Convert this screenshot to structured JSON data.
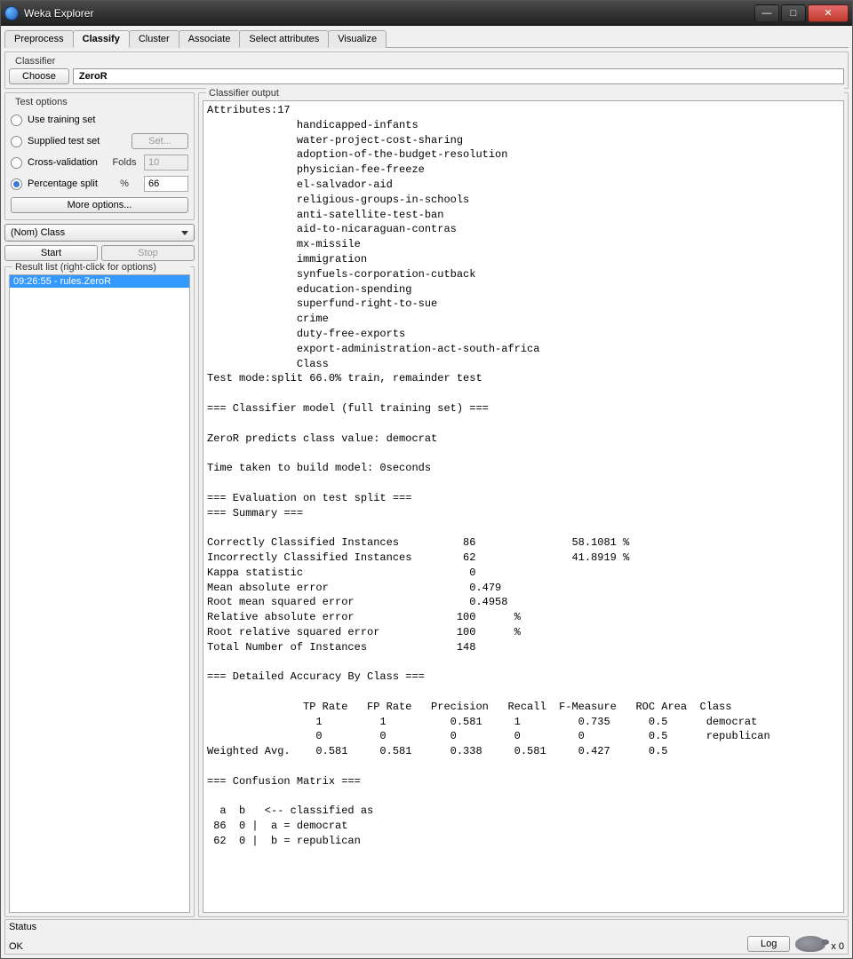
{
  "window": {
    "title": "Weka Explorer"
  },
  "tabs": [
    "Preprocess",
    "Classify",
    "Cluster",
    "Associate",
    "Select attributes",
    "Visualize"
  ],
  "active_tab_index": 1,
  "classifier": {
    "section": "Classifier",
    "choose": "Choose",
    "name": "ZeroR"
  },
  "test_options": {
    "section": "Test options",
    "use_training": "Use training set",
    "supplied": "Supplied test set",
    "set_btn": "Set...",
    "cross_val": "Cross-validation",
    "folds_label": "Folds",
    "folds_value": "10",
    "percentage": "Percentage split",
    "pct_label": "%",
    "pct_value": "66",
    "more": "More options...",
    "selected": "percentage"
  },
  "class_combo": "(Nom) Class",
  "start": "Start",
  "stop": "Stop",
  "result_list": {
    "section": "Result list (right-click for options)",
    "items": [
      "09:26:55 - rules.ZeroR"
    ],
    "selected_index": 0
  },
  "output": {
    "section": "Classifier output",
    "text": "Attributes:17\n              handicapped-infants\n              water-project-cost-sharing\n              adoption-of-the-budget-resolution\n              physician-fee-freeze\n              el-salvador-aid\n              religious-groups-in-schools\n              anti-satellite-test-ban\n              aid-to-nicaraguan-contras\n              mx-missile\n              immigration\n              synfuels-corporation-cutback\n              education-spending\n              superfund-right-to-sue\n              crime\n              duty-free-exports\n              export-administration-act-south-africa\n              Class\nTest mode:split 66.0% train, remainder test\n\n=== Classifier model (full training set) ===\n\nZeroR predicts class value: democrat\n\nTime taken to build model: 0seconds\n\n=== Evaluation on test split ===\n=== Summary ===\n\nCorrectly Classified Instances          86               58.1081 %\nIncorrectly Classified Instances        62               41.8919 %\nKappa statistic                          0     \nMean absolute error                      0.479 \nRoot mean squared error                  0.4958\nRelative absolute error                100      %\nRoot relative squared error            100      %\nTotal Number of Instances              148     \n\n=== Detailed Accuracy By Class ===\n\n               TP Rate   FP Rate   Precision   Recall  F-Measure   ROC Area  Class\n                 1         1          0.581     1         0.735      0.5      democrat\n                 0         0          0         0         0          0.5      republican\nWeighted Avg.    0.581     0.581      0.338     0.581     0.427      0.5  \n\n=== Confusion Matrix ===\n\n  a  b   <-- classified as\n 86  0 |  a = democrat\n 62  0 |  b = republican\n"
  },
  "status": {
    "label": "Status",
    "text": "OK",
    "log": "Log",
    "counter": "x 0"
  }
}
